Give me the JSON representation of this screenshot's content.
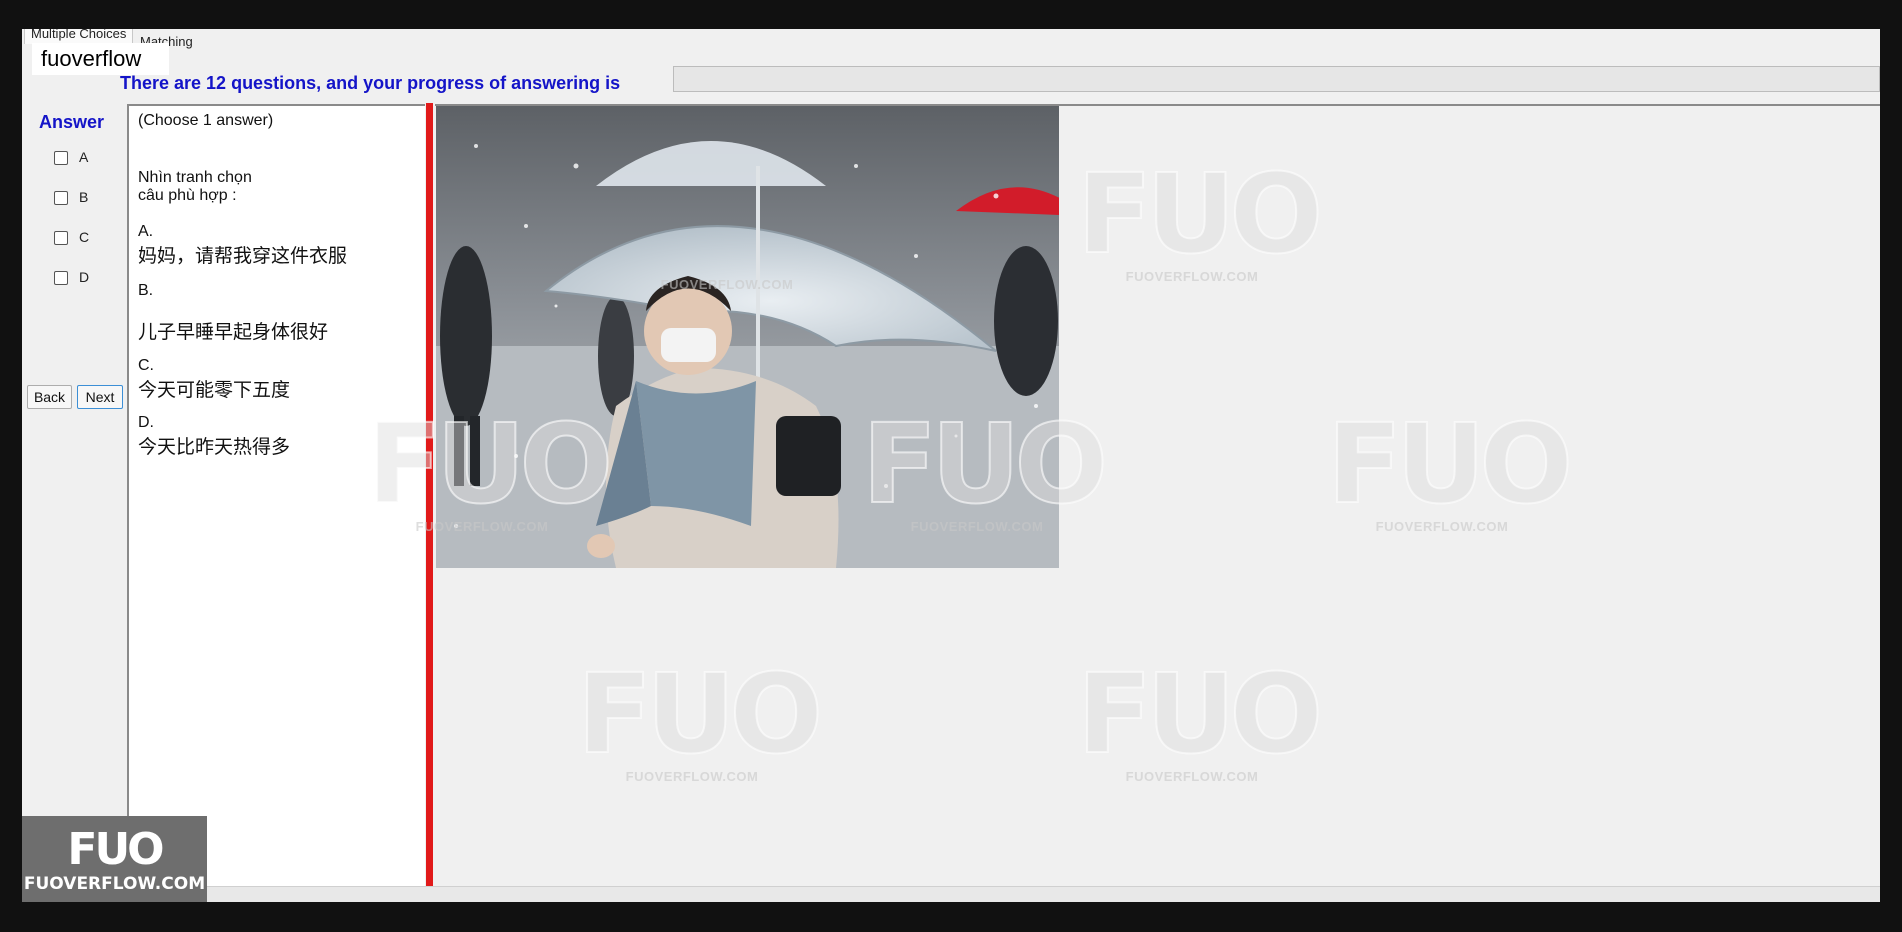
{
  "tabs": [
    "Multiple Choices",
    "Matching"
  ],
  "user": {
    "name": "fuoverflow"
  },
  "progress": {
    "label": "There are 12 questions, and your progress of answering is",
    "total_questions": 12,
    "value": 0
  },
  "answer": {
    "heading": "Answer",
    "options": [
      "A",
      "B",
      "C",
      "D"
    ]
  },
  "nav": {
    "back": "Back",
    "next": "Next"
  },
  "question": {
    "instruction": "(Choose 1 answer)",
    "prompt_line1": "Nhìn tranh chọn",
    "prompt_line2": "câu phù hợp :",
    "choices": [
      {
        "letter": "A.",
        "text": "妈妈，请帮我穿这件衣服"
      },
      {
        "letter": "B.",
        "text": "儿子早睡早起身体很好"
      },
      {
        "letter": "C.",
        "text": " 今天可能零下五度"
      },
      {
        "letter": "D.",
        "text": "今天比昨天热得多"
      }
    ]
  },
  "watermark": {
    "mark": "FUO",
    "url": "FUOVERFLOW.COM"
  },
  "colors": {
    "accent_blue": "#1414c8",
    "splitter_red": "#e11a1a",
    "umbrella_red": "#d21c2a"
  }
}
